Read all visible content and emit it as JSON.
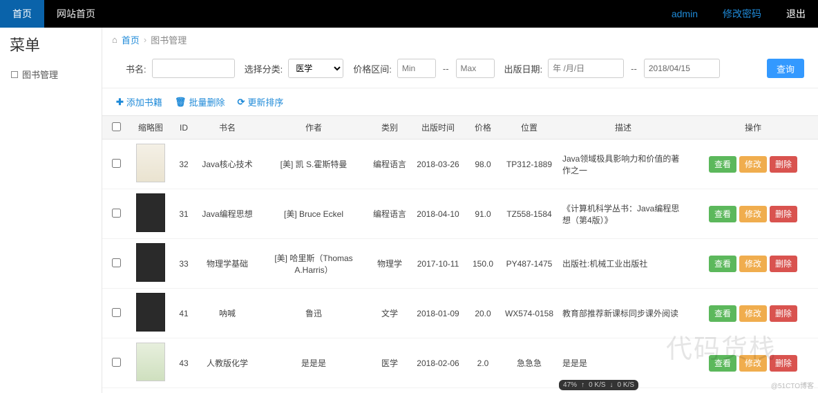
{
  "topnav": {
    "home": "首页",
    "siteHome": "网站首页",
    "user": "admin",
    "changePw": "修改密码",
    "logout": "退出"
  },
  "sidebar": {
    "title": "菜单",
    "item1": "图书管理"
  },
  "breadcrumb": {
    "homeIcon": "⌂",
    "home": "首页",
    "current": "图书管理"
  },
  "filters": {
    "bookLabel": "书名:",
    "categoryLabel": "选择分类:",
    "categoryValue": "医学",
    "priceLabel": "价格区间:",
    "minPlaceholder": "Min",
    "maxPlaceholder": "Max",
    "dateLabel": "出版日期:",
    "dateFromPlaceholder": "年 /月/日",
    "dateToValue": "2018/04/15",
    "searchBtn": "查询"
  },
  "actions": {
    "add": "添加书籍",
    "batchDelete": "批量删除",
    "resort": "更新排序"
  },
  "columns": {
    "thumb": "缩略图",
    "id": "ID",
    "name": "书名",
    "author": "作者",
    "category": "类别",
    "pubDate": "出版时间",
    "price": "价格",
    "location": "位置",
    "desc": "描述",
    "ops": "操作"
  },
  "buttons": {
    "view": "查看",
    "edit": "修改",
    "delete": "删除"
  },
  "rows": [
    {
      "thumbClass": "java",
      "id": "32",
      "name": "Java核心技术",
      "author": "[美] 凯 S.霍斯特曼",
      "category": "编程语言",
      "pubDate": "2018-03-26",
      "price": "98.0",
      "location": "TP312-1889",
      "desc": "Java领域极具影响力和价值的著作之一"
    },
    {
      "thumbClass": "dark",
      "id": "31",
      "name": "Java编程思想",
      "author": "[美] Bruce Eckel",
      "category": "编程语言",
      "pubDate": "2018-04-10",
      "price": "91.0",
      "location": "TZ558-1584",
      "desc": "《计算机科学丛书：Java编程思想（第4版）》"
    },
    {
      "thumbClass": "dark",
      "id": "33",
      "name": "物理学基础",
      "author": "[美] 哈里斯（Thomas A.Harris）",
      "category": "物理学",
      "pubDate": "2017-10-11",
      "price": "150.0",
      "location": "PY487-1475",
      "desc": "出版社:机械工业出版社"
    },
    {
      "thumbClass": "dark",
      "id": "41",
      "name": "呐喊",
      "author": "鲁迅",
      "category": "文学",
      "pubDate": "2018-01-09",
      "price": "20.0",
      "location": "WX574-0158",
      "desc": "教育部推荐新课标同步课外阅读"
    },
    {
      "thumbClass": "chem",
      "id": "43",
      "name": "人教版化学",
      "author": "是是是",
      "category": "医学",
      "pubDate": "2018-02-06",
      "price": "2.0",
      "location": "急急急",
      "desc": "是是是"
    }
  ],
  "watermark": "代码货栈",
  "footermark": "@51CTO博客",
  "netbadge": {
    "pct": "47%",
    "up": "0 K/S",
    "down": "0 K/S"
  }
}
